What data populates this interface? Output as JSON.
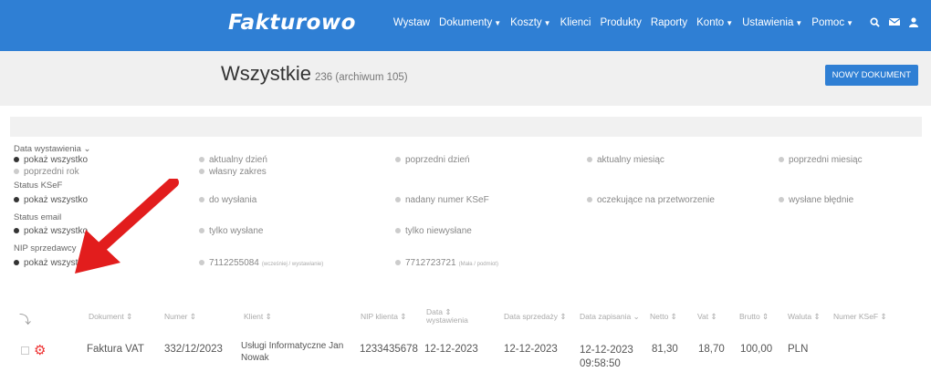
{
  "header": {
    "logo": "Fakturowo",
    "nav": [
      {
        "label": "Wystaw",
        "caret": false
      },
      {
        "label": "Dokumenty",
        "caret": true
      },
      {
        "label": "Koszty",
        "caret": true
      },
      {
        "label": "Klienci",
        "caret": false
      },
      {
        "label": "Produkty",
        "caret": false
      },
      {
        "label": "Raporty",
        "caret": false
      },
      {
        "label": "Konto",
        "caret": true
      },
      {
        "label": "Ustawienia",
        "caret": true
      },
      {
        "label": "Pomoc",
        "caret": true
      }
    ],
    "icons": [
      "search-icon",
      "mail-icon",
      "user-icon"
    ]
  },
  "page": {
    "title": "Wszystkie",
    "count": "236 (archiwum 105)",
    "new_button": "NOWY DOKUMENT"
  },
  "filters": {
    "date": {
      "title": "Data wystawienia ⌄",
      "row1": [
        "pokaż wszystko",
        "aktualny dzień",
        "poprzedni dzień",
        "aktualny miesiąc",
        "poprzedni miesiąc"
      ],
      "row2": [
        "poprzedni rok",
        "własny zakres"
      ]
    },
    "ksef": {
      "title": "Status KSeF",
      "options": [
        "pokaż wszystko",
        "do wysłania",
        "nadany numer KSeF",
        "oczekujące na przetworzenie",
        "wysłane błędnie"
      ]
    },
    "email": {
      "title": "Status email",
      "options": [
        "pokaż wszystko",
        "tylko wysłane",
        "tylko niewysłane"
      ]
    },
    "nip": {
      "title": "NIP sprzedawcy",
      "options": [
        "pokaż wszystko",
        "7112255084",
        "7712723721"
      ],
      "subs": [
        "",
        "(wcześniej / wystawianie)",
        "(Mała / podmiot)"
      ]
    }
  },
  "table": {
    "headers": [
      "Dokument ⇕",
      "Numer ⇕",
      "Klient ⇕",
      "NIP klienta ⇕",
      "Data ⇕",
      "wystawienia",
      "Data sprzedaży ⇕",
      "Data zapisania ⌄",
      "Netto ⇕",
      "Vat ⇕",
      "Brutto ⇕",
      "Waluta ⇕",
      "Numer KSeF ⇕"
    ],
    "rows": [
      {
        "dokument": "Faktura VAT",
        "numer": "332/12/2023",
        "klient_l1": "Usługi Informatyczne Jan",
        "klient_l2": "Nowak",
        "nip": "1233435678",
        "data_wyst": "12-12-2023",
        "data_sprz": "12-12-2023",
        "data_zap": "12-12-2023",
        "czas_zap": "09:58:50",
        "netto": "81,30",
        "vat": "18,70",
        "brutto": "100,00",
        "waluta": "PLN"
      }
    ]
  },
  "colors": {
    "brand": "#2f7fd4",
    "arrow": "#e21d1d",
    "gear": "#e33333"
  }
}
